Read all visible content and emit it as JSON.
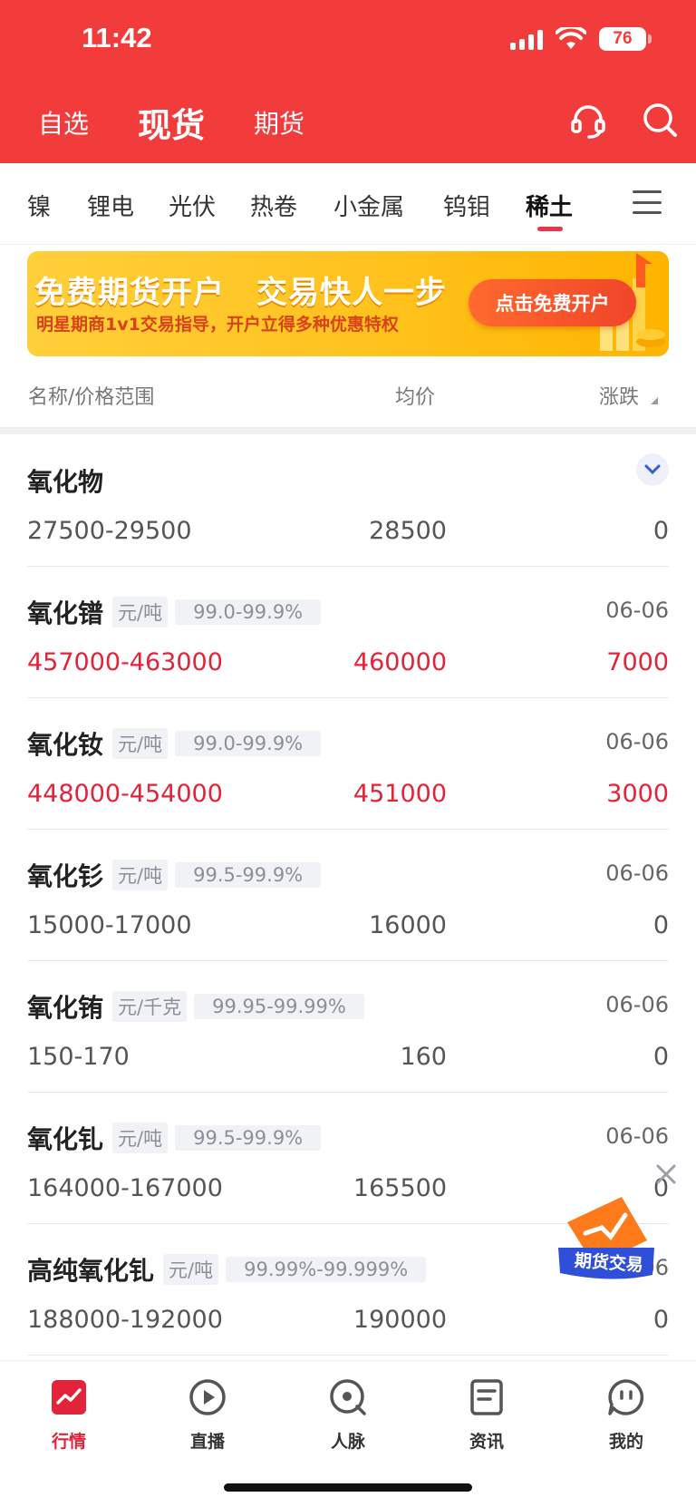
{
  "status_bar": {
    "time": "11:42",
    "battery": "76"
  },
  "top_tabs": [
    {
      "label": "自选",
      "active": false
    },
    {
      "label": "现货",
      "active": true
    },
    {
      "label": "期货",
      "active": false
    }
  ],
  "icons": {
    "service": "headset-icon",
    "search": "search-icon",
    "menu": "menu-icon"
  },
  "categories": [
    {
      "label": "镍"
    },
    {
      "label": "锂电"
    },
    {
      "label": "光伏"
    },
    {
      "label": "热卷"
    },
    {
      "label": "小金属"
    },
    {
      "label": "钨钼"
    },
    {
      "label": "稀土",
      "active": true
    }
  ],
  "banner": {
    "title": "免费期货开户　交易快人一步",
    "subtitle": "明星期商1v1交易指导，开户立得多种优惠特权",
    "button": "点击免费开户"
  },
  "columns": {
    "name": "名称/价格范围",
    "avg": "均价",
    "change": "涨跌"
  },
  "rows": [
    {
      "name": "氧化物",
      "range": "27500-29500",
      "avg": "28500",
      "change": "0"
    },
    {
      "name": "氧化镨",
      "unit": "元/吨",
      "purity": "99.0-99.9%",
      "date": "06-06",
      "range": "457000-463000",
      "avg": "460000",
      "change": "7000"
    },
    {
      "name": "氧化钕",
      "unit": "元/吨",
      "purity": "99.0-99.9%",
      "date": "06-06",
      "range": "448000-454000",
      "avg": "451000",
      "change": "3000"
    },
    {
      "name": "氧化钐",
      "unit": "元/吨",
      "purity": "99.5-99.9%",
      "date": "06-06",
      "range": "15000-17000",
      "avg": "16000",
      "change": "0"
    },
    {
      "name": "氧化铕",
      "unit": "元/千克",
      "purity": "99.95-99.99%",
      "date": "06-06",
      "range": "150-170",
      "avg": "160",
      "change": "0"
    },
    {
      "name": "氧化钆",
      "unit": "元/吨",
      "purity": "99.5-99.9%",
      "date": "06-06",
      "range": "164000-167000",
      "avg": "165500",
      "change": "0"
    },
    {
      "name": "高纯氧化钆",
      "unit": "元/吨",
      "purity": "99.99%-99.999%",
      "date": "06-06",
      "range": "188000-192000",
      "avg": "190000",
      "change": "0"
    }
  ],
  "float_promo": {
    "label": "期货交易"
  },
  "bottom_nav": [
    {
      "label": "行情",
      "icon": "market-chart-icon",
      "active": true
    },
    {
      "label": "直播",
      "icon": "play-icon"
    },
    {
      "label": "人脉",
      "icon": "network-icon"
    },
    {
      "label": "资讯",
      "icon": "news-icon"
    },
    {
      "label": "我的",
      "icon": "profile-icon"
    }
  ],
  "colors": {
    "brand_red": "#f23c3c",
    "up_red": "#e2233a",
    "banner_yellow": "#ffc21d"
  }
}
